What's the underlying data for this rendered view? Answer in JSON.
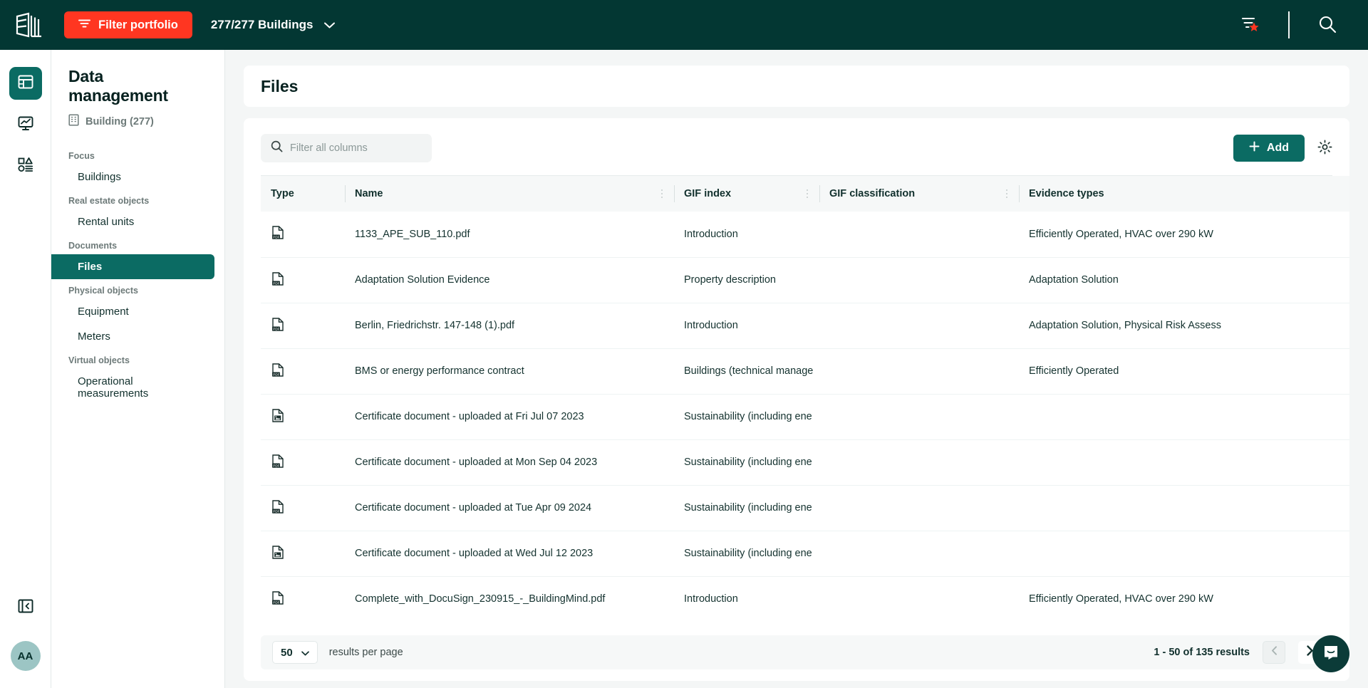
{
  "topbar": {
    "logo_icon": "buildingminds-logo-icon",
    "filter_portfolio_label": "Filter portfolio",
    "filter_icon": "filter-lines-icon",
    "buildings_count_label": "277/277 Buildings",
    "chevron_icon": "chevron-down-icon",
    "saved_filter_icon": "filter-star-icon",
    "search_icon": "search-icon",
    "bg_color": "#033733",
    "accent_color": "#ff3621"
  },
  "rail": {
    "items": [
      {
        "name": "data-management",
        "icon": "table-grid-icon",
        "active": true
      },
      {
        "name": "analytics",
        "icon": "monitor-chart-icon",
        "active": false
      },
      {
        "name": "objects",
        "icon": "shapes-list-icon",
        "active": false
      }
    ],
    "collapse_icon": "collapse-panel-icon",
    "avatar_initials": "AA",
    "avatar_color": "#9cc5c4"
  },
  "nav": {
    "title": "Data management",
    "context_icon": "building-icon",
    "context_label": "Building (277)",
    "groups": [
      {
        "label": "Focus",
        "items": [
          {
            "label": "Buildings",
            "active": false
          }
        ]
      },
      {
        "label": "Real estate objects",
        "items": [
          {
            "label": "Rental units",
            "active": false
          }
        ]
      },
      {
        "label": "Documents",
        "items": [
          {
            "label": "Files",
            "active": true
          }
        ]
      },
      {
        "label": "Physical objects",
        "items": [
          {
            "label": "Equipment",
            "active": false
          },
          {
            "label": "Meters",
            "active": false
          }
        ]
      },
      {
        "label": "Virtual objects",
        "items": [
          {
            "label": "Operational measurements",
            "active": false
          }
        ]
      }
    ],
    "active_color": "#0b6b63"
  },
  "page": {
    "title": "Files"
  },
  "toolbar": {
    "search_placeholder": "Filter all columns",
    "search_value": "",
    "search_icon": "search-icon",
    "add_label": "Add",
    "add_icon": "plus-icon",
    "settings_icon": "gear-icon"
  },
  "table": {
    "columns": [
      {
        "label": "Type",
        "key": "type"
      },
      {
        "label": "Name",
        "key": "name"
      },
      {
        "label": "GIF index",
        "key": "gif_index"
      },
      {
        "label": "GIF classification",
        "key": "gif_classification"
      },
      {
        "label": "Evidence types",
        "key": "evidence_types"
      }
    ],
    "rows": [
      {
        "type_icon": "pdf-file-icon",
        "name": "1133_APE_SUB_110.pdf",
        "gif_index": "Introduction",
        "gif_classification": "",
        "evidence_types": "Efficiently Operated, HVAC over 290 kW"
      },
      {
        "type_icon": "pdf-file-icon",
        "name": "Adaptation Solution Evidence",
        "gif_index": "Property description",
        "gif_classification": "",
        "evidence_types": "Adaptation Solution"
      },
      {
        "type_icon": "pdf-file-icon",
        "name": "Berlin, Friedrichstr. 147-148 (1).pdf",
        "gif_index": "Introduction",
        "gif_classification": "",
        "evidence_types": "Adaptation Solution, Physical Risk Assess"
      },
      {
        "type_icon": "pdf-file-icon",
        "name": "BMS or energy performance contract",
        "gif_index": "Buildings (technical manage",
        "gif_classification": "",
        "evidence_types": "Efficiently Operated"
      },
      {
        "type_icon": "image-file-icon",
        "name": "Certificate document - uploaded at Fri Jul 07 2023",
        "gif_index": "Sustainability (including ene",
        "gif_classification": "",
        "evidence_types": ""
      },
      {
        "type_icon": "pdf-file-icon",
        "name": "Certificate document - uploaded at Mon Sep 04 2023",
        "gif_index": "Sustainability (including ene",
        "gif_classification": "",
        "evidence_types": ""
      },
      {
        "type_icon": "pdf-file-icon",
        "name": "Certificate document - uploaded at Tue Apr 09 2024",
        "gif_index": "Sustainability (including ene",
        "gif_classification": "",
        "evidence_types": ""
      },
      {
        "type_icon": "image-file-icon",
        "name": "Certificate document - uploaded at Wed Jul 12 2023",
        "gif_index": "Sustainability (including ene",
        "gif_classification": "",
        "evidence_types": ""
      },
      {
        "type_icon": "pdf-file-icon",
        "name": "Complete_with_DocuSign_230915_-_BuildingMind.pdf",
        "gif_index": "Introduction",
        "gif_classification": "",
        "evidence_types": "Efficiently Operated, HVAC over 290 kW"
      }
    ]
  },
  "footer": {
    "per_page_value": "50",
    "per_page_chevron_icon": "chevron-down-icon",
    "per_page_label": "results per page",
    "results_text": "1 - 50 of 135 results",
    "prev_icon": "chevron-left-icon",
    "next_icon": "chevron-right-icon",
    "prev_disabled": true
  },
  "chat": {
    "icon": "intercom-chat-icon",
    "color": "#0b3b38"
  }
}
